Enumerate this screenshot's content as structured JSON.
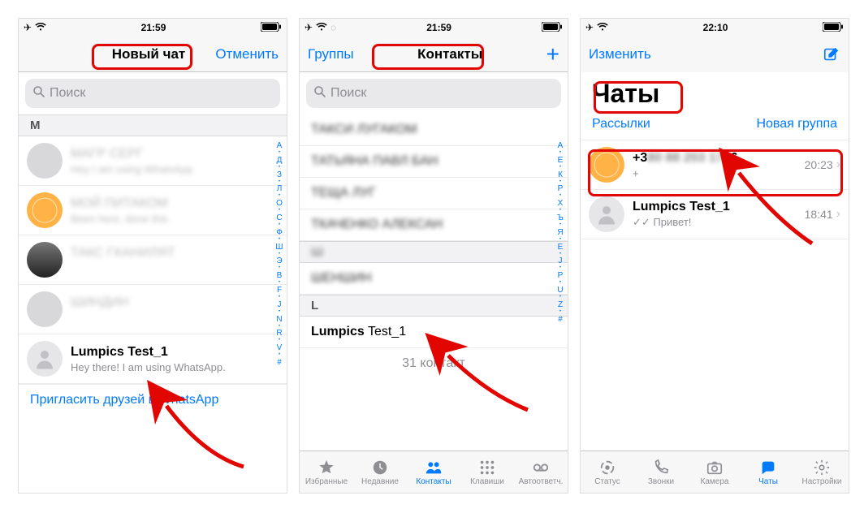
{
  "status": {
    "time1": "21:59",
    "time2": "21:59",
    "time3": "22:10"
  },
  "phone1": {
    "title": "Новый чат",
    "cancel": "Отменить",
    "search_placeholder": "Поиск",
    "section_m": "M",
    "contacts_blur": [
      {
        "name": "МАГР СЕРГ",
        "sub": "Hey I am using WhatsApp"
      },
      {
        "name": "МОЙ ПИТАКОМ",
        "sub": "Been here, done this"
      },
      {
        "name": "ТАКС ГКАНИЛЯТ",
        "sub": ""
      },
      {
        "name": "ШИНДИН",
        "sub": ""
      }
    ],
    "lumpics": {
      "name": "Lumpics Test_1",
      "sub": "Hey there! I am using WhatsApp."
    },
    "invite": "Пригласить друзей в WhatsApp",
    "alpha": [
      "А",
      "•",
      "Д",
      "•",
      "З",
      "•",
      "Л",
      "•",
      "О",
      "•",
      "С",
      "•",
      "Ф",
      "•",
      "Ш",
      "•",
      "Э",
      "•",
      "B",
      "•",
      "F",
      "•",
      "J",
      "•",
      "N",
      "•",
      "R",
      "•",
      "V",
      "•",
      "#"
    ]
  },
  "phone2": {
    "groups": "Группы",
    "title": "Контакты",
    "search_placeholder": "Поиск",
    "blur_names": [
      "ТАКСИ ЛУГАКОМ",
      "ТАТЬЯНА ПАВЛ БАН",
      "ТЕЩА ЛУГ",
      "ТКАЧЕНКО АЛЕКСАН",
      "Ш",
      "ШЕНШИН"
    ],
    "section_l": "L",
    "lumpics_first": "Lumpics",
    "lumpics_last": "Test_1",
    "count": "31 контакт",
    "tabs": {
      "fav": "Избранные",
      "recent": "Недавние",
      "contacts": "Контакты",
      "keys": "Клавиши",
      "voice": "Автоответч."
    },
    "alpha": [
      "А",
      "•",
      "Е",
      "•",
      "К",
      "•",
      "Р",
      "•",
      "Х",
      "•",
      "Ъ",
      "•",
      "Я",
      "•",
      "E",
      "•",
      "J",
      "•",
      "P",
      "•",
      "U",
      "•",
      "Z",
      "•",
      "#"
    ]
  },
  "phone3": {
    "edit": "Изменить",
    "title": "Чаты",
    "broadcasts": "Рассылки",
    "newgroup": "Новая группа",
    "chat1": {
      "name_prefix": "+3",
      "name_blur": "80 88 203 17",
      "name_suffix": "16",
      "time": "20:23",
      "sub": "+"
    },
    "chat2": {
      "name": "Lumpics Test_1",
      "time": "18:41",
      "sub": "Привет!"
    },
    "tabs": {
      "status": "Статус",
      "calls": "Звонки",
      "camera": "Камера",
      "chats": "Чаты",
      "settings": "Настройки"
    }
  }
}
